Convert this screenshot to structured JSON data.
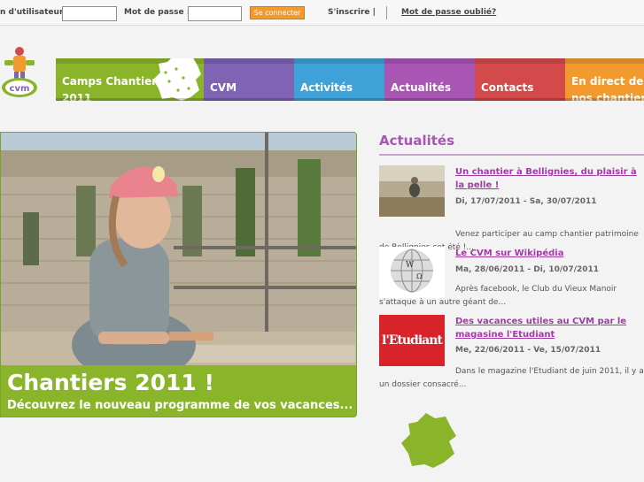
{
  "login": {
    "username_label": "n d'utilisateur :",
    "username_value": "",
    "password_label": "Mot de passe :",
    "password_value": "",
    "submit_label": "Se connecter",
    "register_label": "S'inscrire |",
    "forgot_label": "Mot de passe oublié?"
  },
  "nav": {
    "items": [
      {
        "label": "Camps Chantiers 2011",
        "color": "#8ab52a"
      },
      {
        "label": "CVM",
        "color": "#7f64b4"
      },
      {
        "label": "Activités",
        "color": "#3ea2d8"
      },
      {
        "label": "Actualités",
        "color": "#a855b4"
      },
      {
        "label": "Contacts",
        "color": "#d44a4a"
      },
      {
        "label": "En direct de nos chantiers",
        "color": "#f29a2e"
      }
    ]
  },
  "hero": {
    "title": "Chantiers 2011 !",
    "subtitle": "Découvrez le nouveau programme de vos vacances..."
  },
  "news": {
    "heading": "Actualités",
    "items": [
      {
        "title": "Un chantier à Bellignies, du plaisir à la pelle !",
        "date": "Di, 17/07/2011 - Sa, 30/07/2011",
        "excerpt": "Venez participer au camp chantier patrimoine de Bellignies cet été !..."
      },
      {
        "title": "Le CVM sur Wikipédia",
        "date": "Ma, 28/06/2011 - Di, 10/07/2011",
        "excerpt": "Après facebook, le Club du Vieux Manoir s'attaque à un autre géant de..."
      },
      {
        "title": "Des vacances utiles au CVM par le magasine l'Etudiant",
        "thumb_text": "l'Etudiant",
        "date": "Me, 22/06/2011 - Ve, 15/07/2011",
        "excerpt": "Dans le magazine l'Etudiant de juin 2011, il y a un dossier consacré..."
      }
    ]
  },
  "colors": {
    "green": "#8ab52a",
    "purple_text": "#a855b4",
    "orange_button": "#f29a2e",
    "red_thumb": "#d8232a"
  },
  "icons": [
    "cvm-logo",
    "france-map-icon",
    "wikipedia-globe-icon"
  ]
}
